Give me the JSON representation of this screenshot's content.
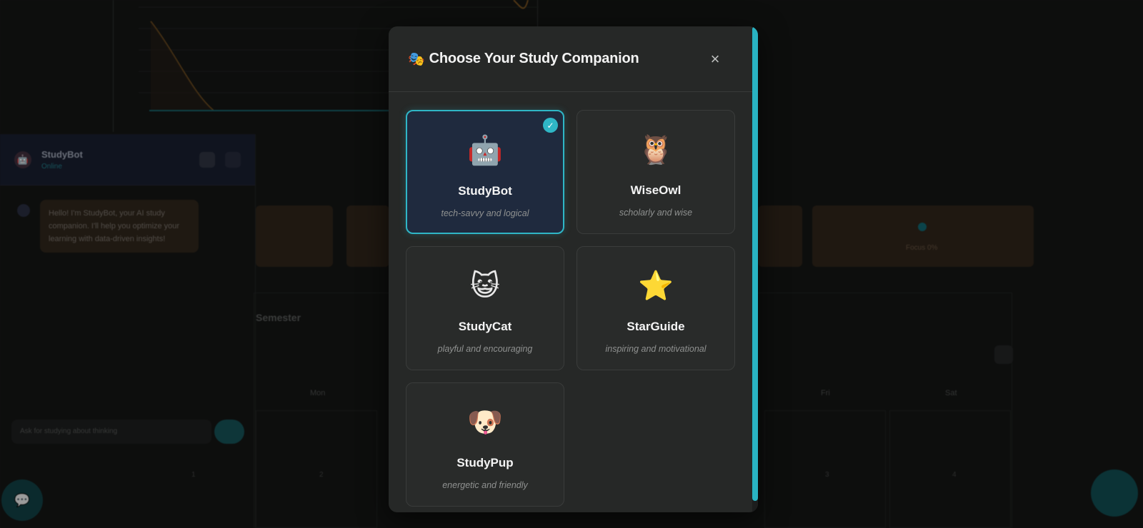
{
  "background": {
    "chat": {
      "title": "StudyBot",
      "status": "Online",
      "message": "Hello! I'm StudyBot, your AI study companion. I'll help you optimize your learning with data-driven insights!",
      "input_placeholder": "Ask for studying about thinking"
    },
    "calendar": {
      "title": "Semester",
      "days": [
        "Mon",
        "Fri",
        "Sat"
      ],
      "numbers": [
        "1",
        "2",
        "3",
        "4"
      ],
      "tile_text": "Focus 0%"
    }
  },
  "modal": {
    "header_icon": "🎭",
    "title": "Choose Your Study Companion",
    "close_label": "×",
    "companions": [
      {
        "icon": "🤖",
        "name": "StudyBot",
        "desc": "tech-savvy and logical",
        "selected": true
      },
      {
        "icon": "🦉",
        "name": "WiseOwl",
        "desc": "scholarly and wise",
        "selected": false
      },
      {
        "icon": "😺",
        "name": "StudyCat",
        "desc": "playful and encouraging",
        "selected": false
      },
      {
        "icon": "⭐",
        "name": "StarGuide",
        "desc": "inspiring and motivational",
        "selected": false
      },
      {
        "icon": "🐶",
        "name": "StudyPup",
        "desc": "energetic and friendly",
        "selected": false
      }
    ],
    "check_mark": "✓"
  },
  "colors": {
    "accent": "#2fb6c6",
    "modal_bg": "#262827",
    "selected_card_bg": "#1f2a3e"
  }
}
